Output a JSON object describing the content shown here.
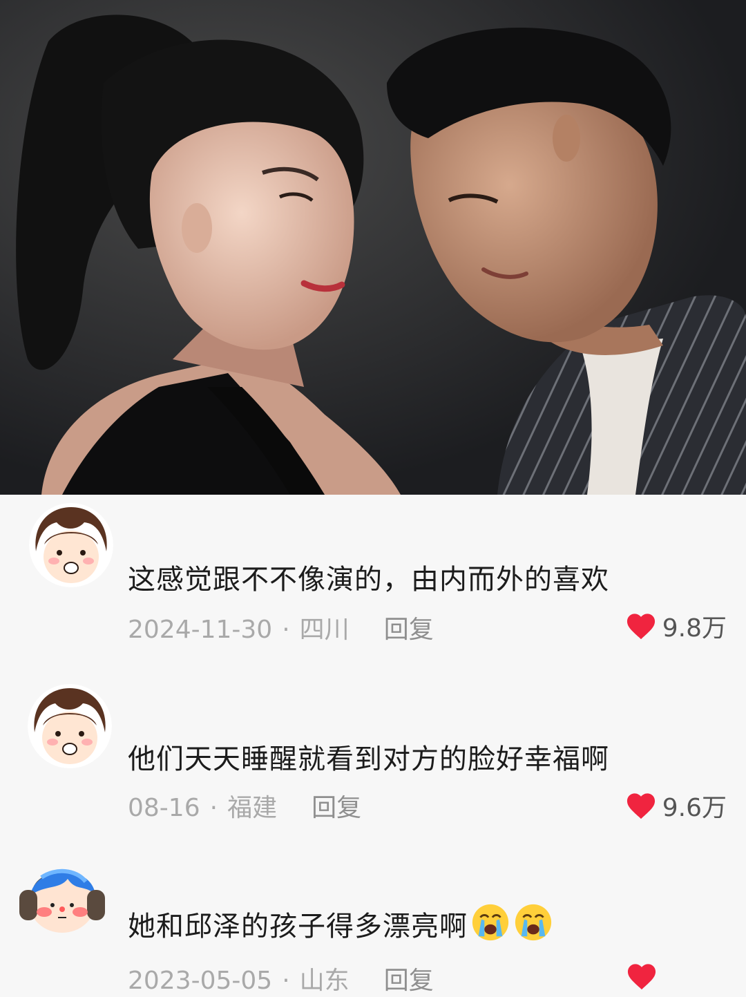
{
  "comments": [
    {
      "text": "这感觉跟不不像演的，由内而外的喜欢",
      "date": "2024-11-30",
      "location": "四川",
      "reply_label": "回复",
      "likes": "9.8万",
      "avatar_icon": "girl-avatar-icon"
    },
    {
      "text": "他们天天睡醒就看到对方的脸好幸福啊",
      "date": "08-16",
      "location": "福建",
      "reply_label": "回复",
      "likes": "9.6万",
      "avatar_icon": "girl-avatar-icon"
    },
    {
      "text": "她和邱泽的孩子得多漂亮啊",
      "date": "2023-05-05",
      "location": "山东",
      "reply_label": "回复",
      "likes": "",
      "avatar_icon": "headphones-avatar-icon",
      "emojis": [
        "crying-face-icon",
        "crying-face-icon"
      ]
    }
  ],
  "meta_separator": "·",
  "colors": {
    "heart": "#f0243f",
    "text": "#1c1c1c",
    "meta": "#a9a9a9",
    "background": "#f7f7f7"
  }
}
